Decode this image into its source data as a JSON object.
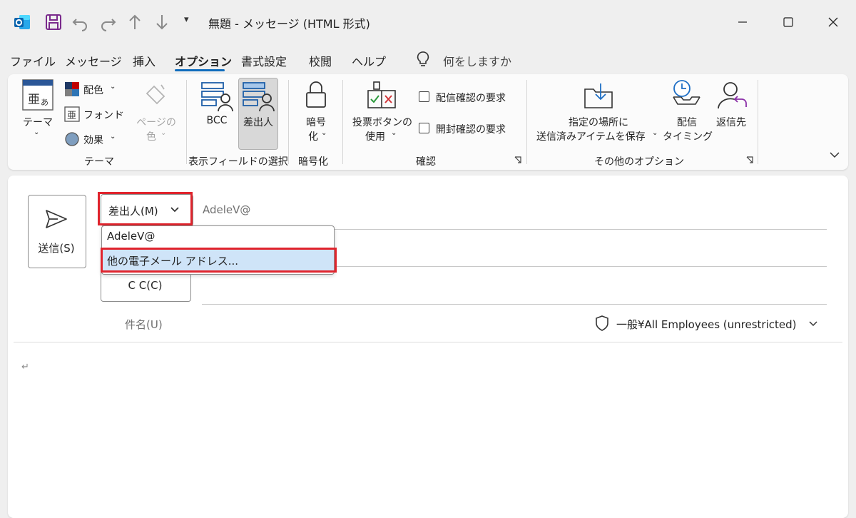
{
  "window": {
    "title": "無題  -  メッセージ (HTML 形式)",
    "qat_dropdown_glyph": "▾",
    "accent_color": "#0f6cbd",
    "highlight_color": "#e0242d"
  },
  "menu": {
    "tabs": [
      "ファイル",
      "メッセージ",
      "挿入",
      "オプション",
      "書式設定",
      "校閲",
      "ヘルプ"
    ],
    "active_tab": "オプション",
    "search_placeholder": "何をしますか"
  },
  "ribbon": {
    "theme_group": {
      "name": "テーマ",
      "theme_button": "テーマ",
      "colors": "配色",
      "fonts": "フォント",
      "effects": "効果",
      "page_color_line1": "ページの",
      "page_color_line2": "色"
    },
    "fields_group": {
      "name": "表示フィールドの選択",
      "bcc": "BCC",
      "from": "差出人"
    },
    "encrypt_group": {
      "name": "暗号化",
      "encrypt_line1": "暗号",
      "encrypt_line2": "化"
    },
    "tracking_group": {
      "name": "確認",
      "voting_line1": "投票ボタンの",
      "voting_line2": "使用",
      "delivery_receipt": "配信確認の要求",
      "read_receipt": "開封確認の要求"
    },
    "more_group": {
      "name": "その他のオプション",
      "save_sent_line1": "指定の場所に",
      "save_sent_line2": "送信済みアイテムを保存",
      "delay_line1": "配信",
      "delay_line2": "タイミング",
      "reply_to": "返信先"
    }
  },
  "compose": {
    "send_label": "送信(S)",
    "from_label": "差出人(M)",
    "from_value": "AdeleV@",
    "dropdown_items": [
      "AdeleV@",
      "他の電子メール アドレス..."
    ],
    "cc_label": "C C(C)",
    "subject_label": "件名(U)",
    "sensitivity_label": "一般¥All Employees (unrestricted)",
    "body_mark": "↵"
  }
}
